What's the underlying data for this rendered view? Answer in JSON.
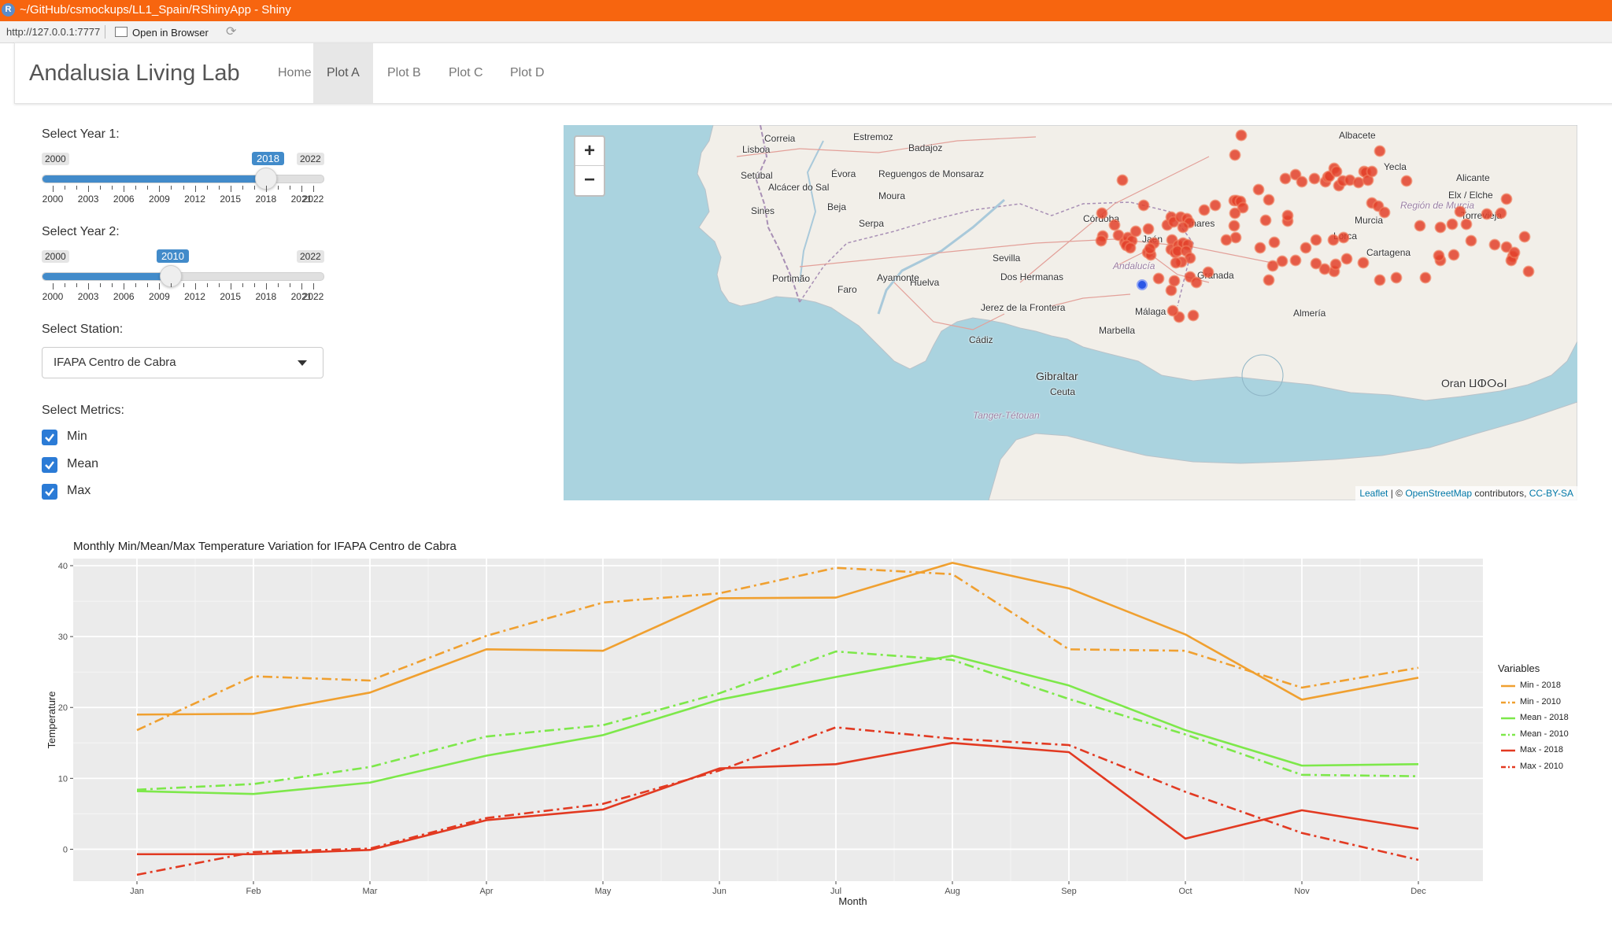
{
  "window": {
    "title": "~/GitHub/csmockups/LL1_Spain/RShinyApp - Shiny",
    "icon": "r-logo-icon"
  },
  "address_bar": {
    "url": "http://127.0.0.1:7777",
    "open_in_browser": "Open in Browser"
  },
  "navbar": {
    "brand": "Andalusia Living Lab",
    "tabs": [
      "Home",
      "Plot A",
      "Plot B",
      "Plot C",
      "Plot D"
    ],
    "active_tab": "Plot A"
  },
  "year1": {
    "label": "Select Year 1:",
    "min": "2000",
    "max": "2022",
    "value": "2018",
    "tick_labels": [
      "2000",
      "2003",
      "2006",
      "2009",
      "2012",
      "2015",
      "2018",
      "2021",
      "2022"
    ]
  },
  "year2": {
    "label": "Select Year 2:",
    "min": "2000",
    "max": "2022",
    "value": "2010",
    "tick_labels": [
      "2000",
      "2003",
      "2006",
      "2009",
      "2012",
      "2015",
      "2018",
      "2021",
      "2022"
    ]
  },
  "station": {
    "label": "Select Station:",
    "selected": "IFAPA Centro de Cabra"
  },
  "metrics": {
    "label": "Select Metrics:",
    "options": [
      {
        "label": "Min",
        "checked": true
      },
      {
        "label": "Mean",
        "checked": true
      },
      {
        "label": "Max",
        "checked": true
      }
    ]
  },
  "map": {
    "place_labels": [
      "Lisboa",
      "Évora",
      "Badajoz",
      "Sevilla",
      "Huelva",
      "Córdoba",
      "Jaén",
      "Linares",
      "Granada",
      "Málaga",
      "Almería",
      "Cádiz",
      "Gibraltar",
      "Ceuta",
      "Marbella",
      "Murcia",
      "Cartagena",
      "Lorca",
      "Albacete",
      "Andalucía",
      "Oran ⵡⵀⵔⴰⵏ",
      "Faro",
      "Portimão",
      "Setúbal",
      "Beja",
      "Serpa",
      "Moura",
      "Ayamonte",
      "Sines",
      "Alcácer do Sal",
      "Reguengos de Monsaraz",
      "Estremoz",
      "Correia",
      "Yecla",
      "Alicante",
      "Elx / Elche",
      "Torrevieja",
      "Región de Murcia",
      "Jerez de la Frontera",
      "Dos Hermanas",
      "Tanger-Tétouan"
    ],
    "zoom_in": "+",
    "zoom_out": "−",
    "attribution": {
      "leaflet": "Leaflet",
      "sep": " | © ",
      "osm": "OpenStreetMap",
      "contrib": " contributors, ",
      "license": "CC-BY-SA"
    },
    "station_color": "#e3412a",
    "selected_station_color": "#2b57e6"
  },
  "chart_data": {
    "type": "line",
    "title": "Monthly Min/Mean/Max Temperature Variation for IFAPA Centro de Cabra",
    "xlabel": "Month",
    "ylabel": "Temperature",
    "categories": [
      "Jan",
      "Feb",
      "Mar",
      "Apr",
      "May",
      "Jun",
      "Jul",
      "Aug",
      "Sep",
      "Oct",
      "Nov",
      "Dec"
    ],
    "yticks": [
      0,
      10,
      20,
      30,
      40
    ],
    "ylim": [
      -4.5,
      41
    ],
    "grid": true,
    "legend_title": "Variables",
    "legend_position": "right",
    "series": [
      {
        "name": "Min - 2018",
        "color": "#f0a030",
        "dashed": false,
        "values": [
          19.0,
          19.1,
          22.1,
          28.2,
          28.0,
          35.4,
          35.5,
          40.4,
          36.8,
          30.3,
          21.1,
          24.2
        ]
      },
      {
        "name": "Min - 2010",
        "color": "#f0a030",
        "dashed": true,
        "values": [
          16.8,
          24.4,
          23.8,
          30.1,
          34.8,
          36.1,
          39.7,
          38.8,
          28.2,
          28.0,
          22.8,
          25.6
        ]
      },
      {
        "name": "Mean - 2018",
        "color": "#7de84a",
        "dashed": false,
        "values": [
          8.2,
          7.8,
          9.4,
          13.2,
          16.1,
          21.1,
          24.3,
          27.3,
          23.1,
          16.8,
          11.8,
          12.0
        ]
      },
      {
        "name": "Mean - 2010",
        "color": "#7de84a",
        "dashed": true,
        "values": [
          8.4,
          9.2,
          11.6,
          15.9,
          17.5,
          22.0,
          27.9,
          26.7,
          21.2,
          16.2,
          10.5,
          10.3
        ]
      },
      {
        "name": "Max - 2018",
        "color": "#e23a22",
        "dashed": false,
        "values": [
          -0.7,
          -0.7,
          -0.1,
          4.1,
          5.6,
          11.4,
          12.0,
          15.0,
          13.7,
          1.5,
          5.5,
          2.9
        ]
      },
      {
        "name": "Max - 2010",
        "color": "#e23a22",
        "dashed": true,
        "values": [
          -3.6,
          -0.4,
          0.1,
          4.4,
          6.4,
          11.1,
          17.2,
          15.6,
          14.7,
          8.1,
          2.3,
          -1.5
        ]
      }
    ]
  }
}
